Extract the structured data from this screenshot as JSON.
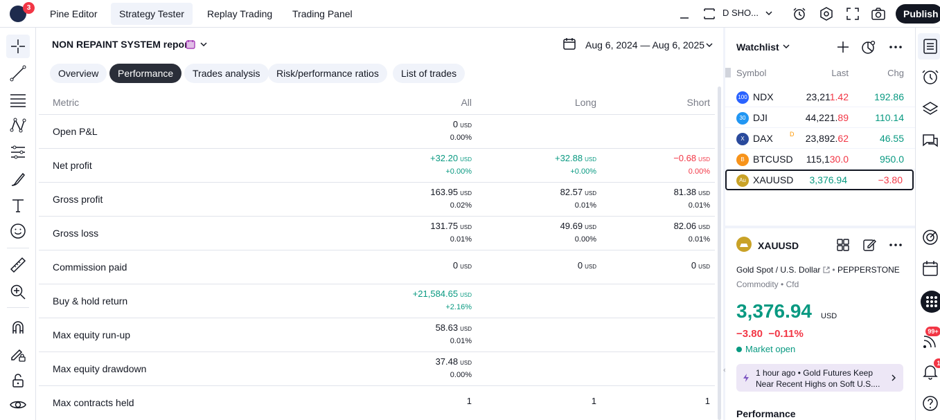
{
  "topbar": {
    "badge_count": "3",
    "tabs": [
      {
        "label": "Pine Editor"
      },
      {
        "label": "Strategy Tester"
      },
      {
        "label": "Replay Trading"
      },
      {
        "label": "Trading Panel"
      }
    ],
    "active_tab": "Strategy Tester",
    "symbol_truncated": "D SHO...",
    "publish_label": "Publish",
    "icons": [
      "minimize-icon",
      "maximize-icon",
      "chevron-down-icon",
      "alert-clock-icon",
      "settings-hex-icon",
      "fullscreen-icon",
      "camera-icon"
    ]
  },
  "left_toolbar": {
    "icons": [
      "crosshair-icon",
      "trend-line-icon",
      "fib-retracement-icon",
      "pattern-icon",
      "forecast-icon",
      "brush-icon",
      "text-icon",
      "emoji-icon",
      "ruler-icon",
      "zoom-in-icon",
      "magnet-icon",
      "lock-drawing-icon",
      "lock-icon",
      "eye-icon"
    ]
  },
  "report": {
    "title": "NON REPAINT SYSTEM report",
    "date_range": "Aug 6, 2024 — Aug 6, 2025",
    "tabs": [
      {
        "label": "Overview"
      },
      {
        "label": "Performance"
      },
      {
        "label": "Trades analysis"
      },
      {
        "label": "Risk/performance ratios"
      },
      {
        "label": "List of trades"
      }
    ],
    "active_tab": "Performance",
    "columns": {
      "metric": "Metric",
      "all": "All",
      "long": "Long",
      "short": "Short"
    },
    "unit": "USD",
    "rows": [
      {
        "label": "Open P&L",
        "all": {
          "value": "0",
          "unit": "USD",
          "pct": "0.00%",
          "tone": ""
        },
        "long": null,
        "short": null
      },
      {
        "label": "Net profit",
        "all": {
          "value": "+32.20",
          "unit": "USD",
          "pct": "+0.00%",
          "tone": "pos"
        },
        "long": {
          "value": "+32.88",
          "unit": "USD",
          "pct": "+0.00%",
          "tone": "pos"
        },
        "short": {
          "value": "−0.68",
          "unit": "USD",
          "pct": "0.00%",
          "tone": "neg"
        }
      },
      {
        "label": "Gross profit",
        "all": {
          "value": "163.95",
          "unit": "USD",
          "pct": "0.02%",
          "tone": ""
        },
        "long": {
          "value": "82.57",
          "unit": "USD",
          "pct": "0.01%",
          "tone": ""
        },
        "short": {
          "value": "81.38",
          "unit": "USD",
          "pct": "0.01%",
          "tone": ""
        }
      },
      {
        "label": "Gross loss",
        "all": {
          "value": "131.75",
          "unit": "USD",
          "pct": "0.01%",
          "tone": ""
        },
        "long": {
          "value": "49.69",
          "unit": "USD",
          "pct": "0.00%",
          "tone": ""
        },
        "short": {
          "value": "82.06",
          "unit": "USD",
          "pct": "0.01%",
          "tone": ""
        }
      },
      {
        "label": "Commission paid",
        "all": {
          "value": "0",
          "unit": "USD",
          "pct": "",
          "tone": ""
        },
        "long": {
          "value": "0",
          "unit": "USD",
          "pct": "",
          "tone": ""
        },
        "short": {
          "value": "0",
          "unit": "USD",
          "pct": "",
          "tone": ""
        }
      },
      {
        "label": "Buy & hold return",
        "all": {
          "value": "+21,584.65",
          "unit": "USD",
          "pct": "+2.16%",
          "tone": "pos"
        },
        "long": null,
        "short": null
      },
      {
        "label": "Max equity run-up",
        "all": {
          "value": "58.63",
          "unit": "USD",
          "pct": "0.01%",
          "tone": ""
        },
        "long": null,
        "short": null
      },
      {
        "label": "Max equity drawdown",
        "all": {
          "value": "37.48",
          "unit": "USD",
          "pct": "0.00%",
          "tone": ""
        },
        "long": null,
        "short": null
      },
      {
        "label": "Max contracts held",
        "all": {
          "value": "1",
          "unit": "",
          "pct": "",
          "tone": ""
        },
        "long": {
          "value": "1",
          "unit": "",
          "pct": "",
          "tone": ""
        },
        "short": {
          "value": "1",
          "unit": "",
          "pct": "",
          "tone": ""
        }
      }
    ]
  },
  "watchlist": {
    "title": "Watchlist",
    "columns": {
      "symbol": "Symbol",
      "last": "Last",
      "chg": "Chg"
    },
    "items": [
      {
        "badge": "100",
        "badge_color": "#2962ff",
        "symbol": "NDX",
        "flag": "",
        "last_main": "23,21",
        "last_hl": "1.42",
        "last_tone": "neg",
        "chg": "192.86",
        "chg_tone": "pos"
      },
      {
        "badge": "30",
        "badge_color": "#2196f3",
        "symbol": "DJI",
        "flag": "",
        "last_main": "44,221.",
        "last_hl": "89",
        "last_tone": "neg",
        "chg": "110.14",
        "chg_tone": "pos"
      },
      {
        "badge": "X",
        "badge_color": "#2a4a9c",
        "symbol": "DAX",
        "flag": "D",
        "last_main": "23,892.",
        "last_hl": "62",
        "last_tone": "neg",
        "chg": "46.55",
        "chg_tone": "pos"
      },
      {
        "badge": "B",
        "badge_color": "#f7931a",
        "symbol": "BTCUSD",
        "flag": "",
        "last_main": "115,1",
        "last_hl": "30.0",
        "last_tone": "neg",
        "chg": "950.0",
        "chg_tone": "pos"
      },
      {
        "badge": "Au",
        "badge_color": "#c9a227",
        "symbol": "XAUUSD",
        "flag": "",
        "last_main": "3,376.94",
        "last_hl": "",
        "last_tone": "pos",
        "chg": "−3.80",
        "chg_tone": "neg"
      }
    ],
    "selected": "XAUUSD"
  },
  "details": {
    "symbol": "XAUUSD",
    "description": "Gold Spot / U.S. Dollar",
    "exchange": "PEPPERSTONE",
    "type": "Commodity",
    "subtype": "Cfd",
    "price": "3,376.94",
    "price_unit": "USD",
    "change": "−3.80",
    "change_pct": "−0.11%",
    "market_status": "Market open",
    "news_time": "1 hour ago",
    "news_headline": "Gold Futures Keep Near Recent Highs on Soft U.S....",
    "performance_label": "Performance"
  },
  "right_toolbar": {
    "icons": [
      "watchlist-icon",
      "alerts-clock-icon",
      "layers-icon",
      "chat-icon",
      "ideas-icon",
      "calendar-icon",
      "apps-grid-icon",
      "feed-icon",
      "notifications-bell-icon",
      "help-icon"
    ],
    "feed_badge": "99+",
    "bell_badge": "1"
  },
  "colors": {
    "positive": "#089981",
    "negative": "#f23645",
    "text": "#131722",
    "muted": "#787b86",
    "tab_bg": "#f0f3fa",
    "active_tab_bg": "#2a2e39"
  }
}
